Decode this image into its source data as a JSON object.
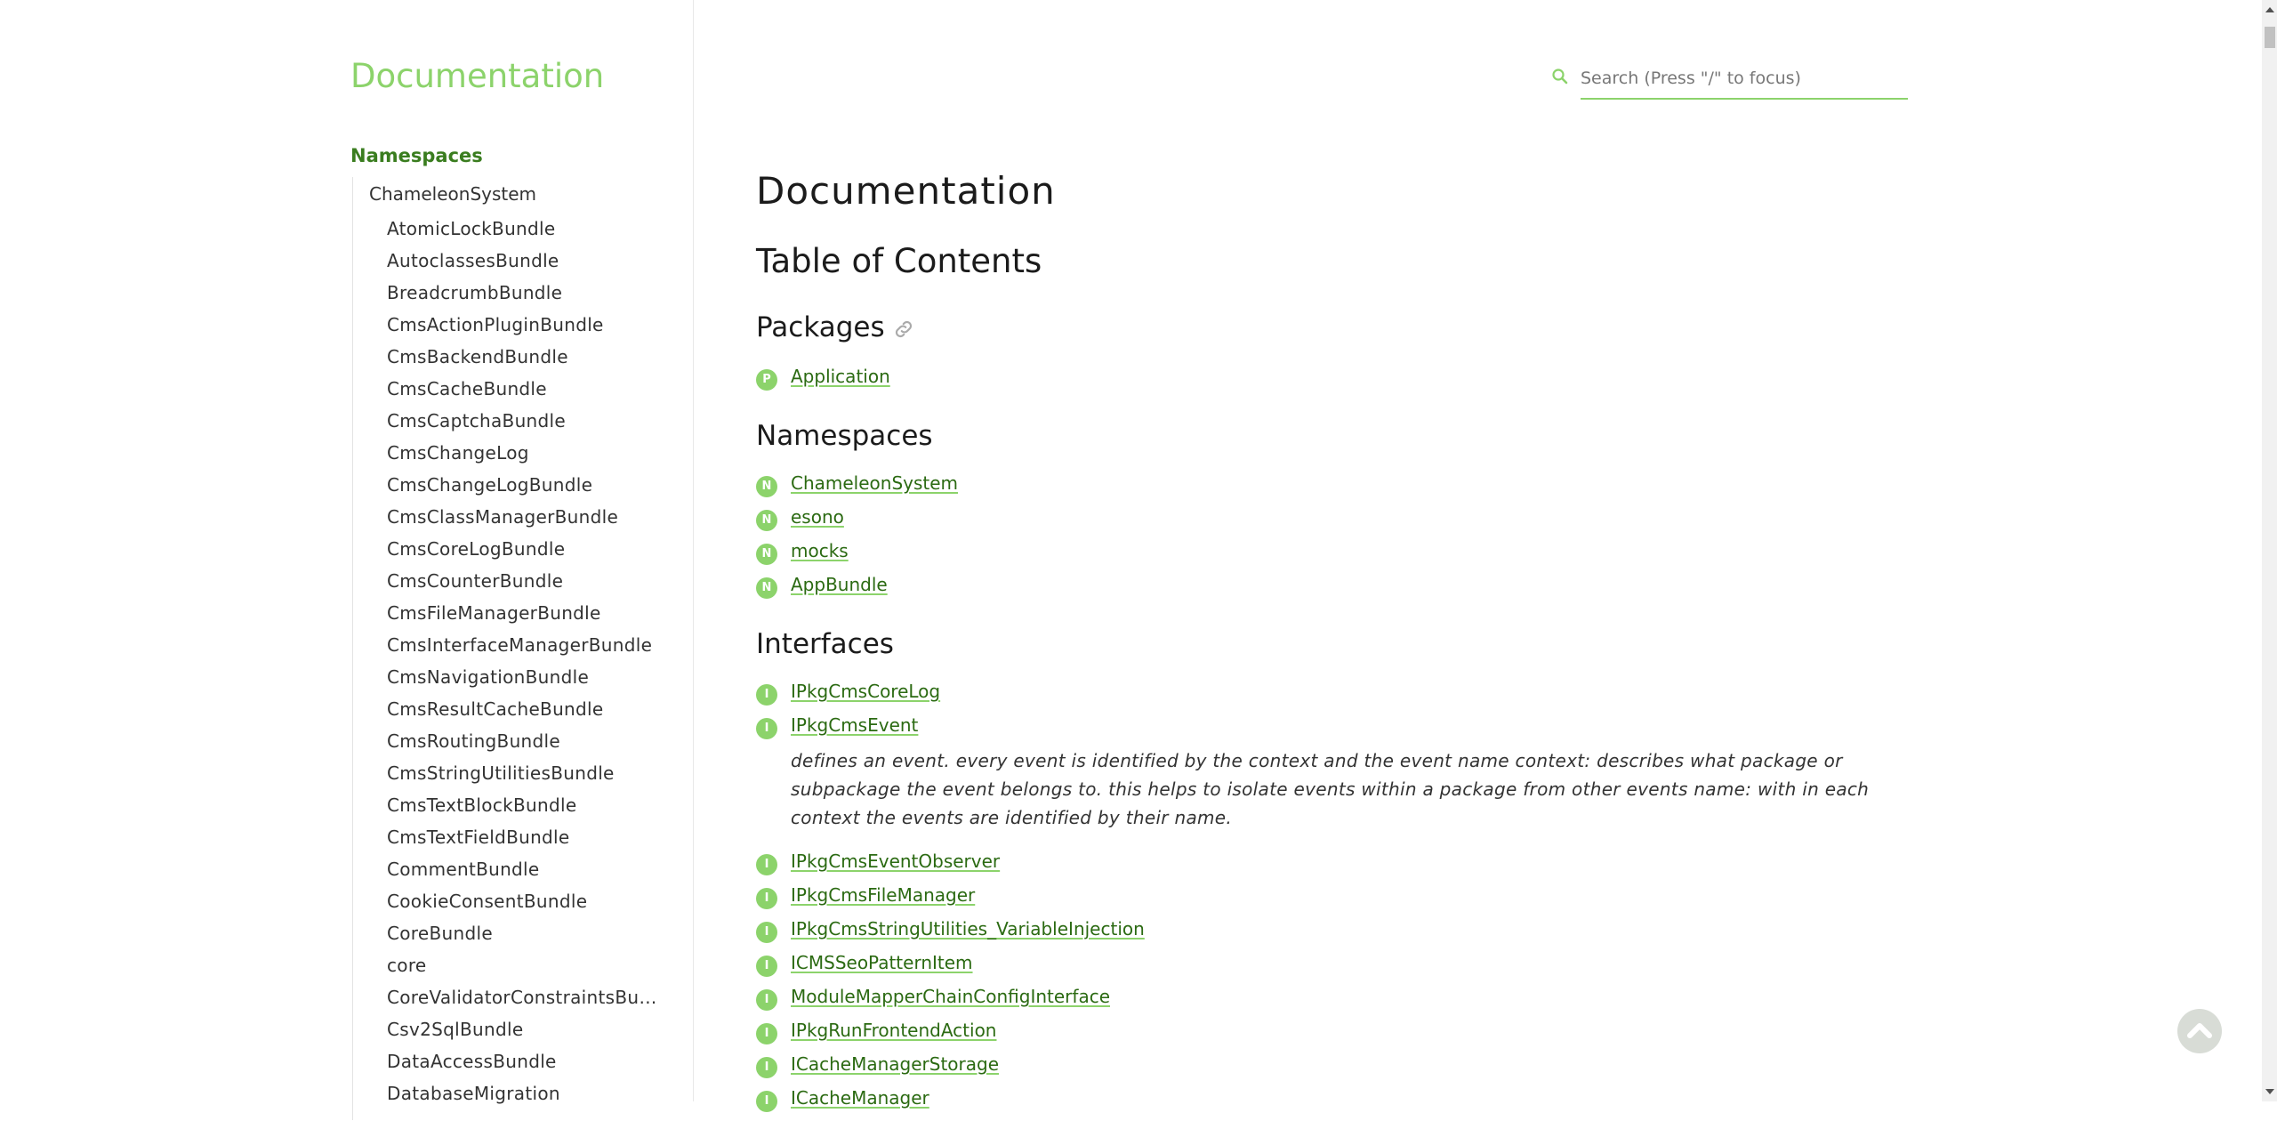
{
  "sidebar": {
    "title": "Documentation",
    "namespaces_heading": "Namespaces",
    "root": "ChameleonSystem",
    "children": [
      "AtomicLockBundle",
      "AutoclassesBundle",
      "BreadcrumbBundle",
      "CmsActionPluginBundle",
      "CmsBackendBundle",
      "CmsCacheBundle",
      "CmsCaptchaBundle",
      "CmsChangeLog",
      "CmsChangeLogBundle",
      "CmsClassManagerBundle",
      "CmsCoreLogBundle",
      "CmsCounterBundle",
      "CmsFileManagerBundle",
      "CmsInterfaceManagerBundle",
      "CmsNavigationBundle",
      "CmsResultCacheBundle",
      "CmsRoutingBundle",
      "CmsStringUtilitiesBundle",
      "CmsTextBlockBundle",
      "CmsTextFieldBundle",
      "CommentBundle",
      "CookieConsentBundle",
      "CoreBundle",
      "core",
      "CoreValidatorConstraintsBun…",
      "Csv2SqlBundle",
      "DataAccessBundle",
      "DatabaseMigration"
    ]
  },
  "search": {
    "placeholder": "Search (Press \"/\" to focus)"
  },
  "main": {
    "title": "Documentation",
    "toc_title": "Table of Contents",
    "packages": {
      "heading": "Packages",
      "items": [
        {
          "badge": "P",
          "label": "Application"
        }
      ]
    },
    "namespaces": {
      "heading": "Namespaces",
      "items": [
        {
          "badge": "N",
          "label": "ChameleonSystem"
        },
        {
          "badge": "N",
          "label": "esono"
        },
        {
          "badge": "N",
          "label": "mocks"
        },
        {
          "badge": "N",
          "label": "AppBundle"
        }
      ]
    },
    "interfaces": {
      "heading": "Interfaces",
      "items_top": [
        {
          "badge": "I",
          "label": "IPkgCmsCoreLog"
        },
        {
          "badge": "I",
          "label": "IPkgCmsEvent"
        }
      ],
      "description": "defines an event. every event is identified by the context and the event name context: describes what package or subpackage the event belongs to. this helps to isolate events within a package from other events name: with in each context the events are identified by their name.",
      "items_bottom": [
        {
          "badge": "I",
          "label": "IPkgCmsEventObserver"
        },
        {
          "badge": "I",
          "label": "IPkgCmsFileManager"
        },
        {
          "badge": "I",
          "label": "IPkgCmsStringUtilities_VariableInjection"
        },
        {
          "badge": "I",
          "label": "ICMSSeoPatternItem"
        },
        {
          "badge": "I",
          "label": "ModuleMapperChainConfigInterface"
        },
        {
          "badge": "I",
          "label": "IPkgRunFrontendAction"
        },
        {
          "badge": "I",
          "label": "ICacheManagerStorage"
        },
        {
          "badge": "I",
          "label": "ICacheManager"
        }
      ]
    }
  },
  "colors": {
    "accent": "#8cd36b",
    "link": "#2b6a12",
    "heading_green": "#3a7d1f"
  }
}
